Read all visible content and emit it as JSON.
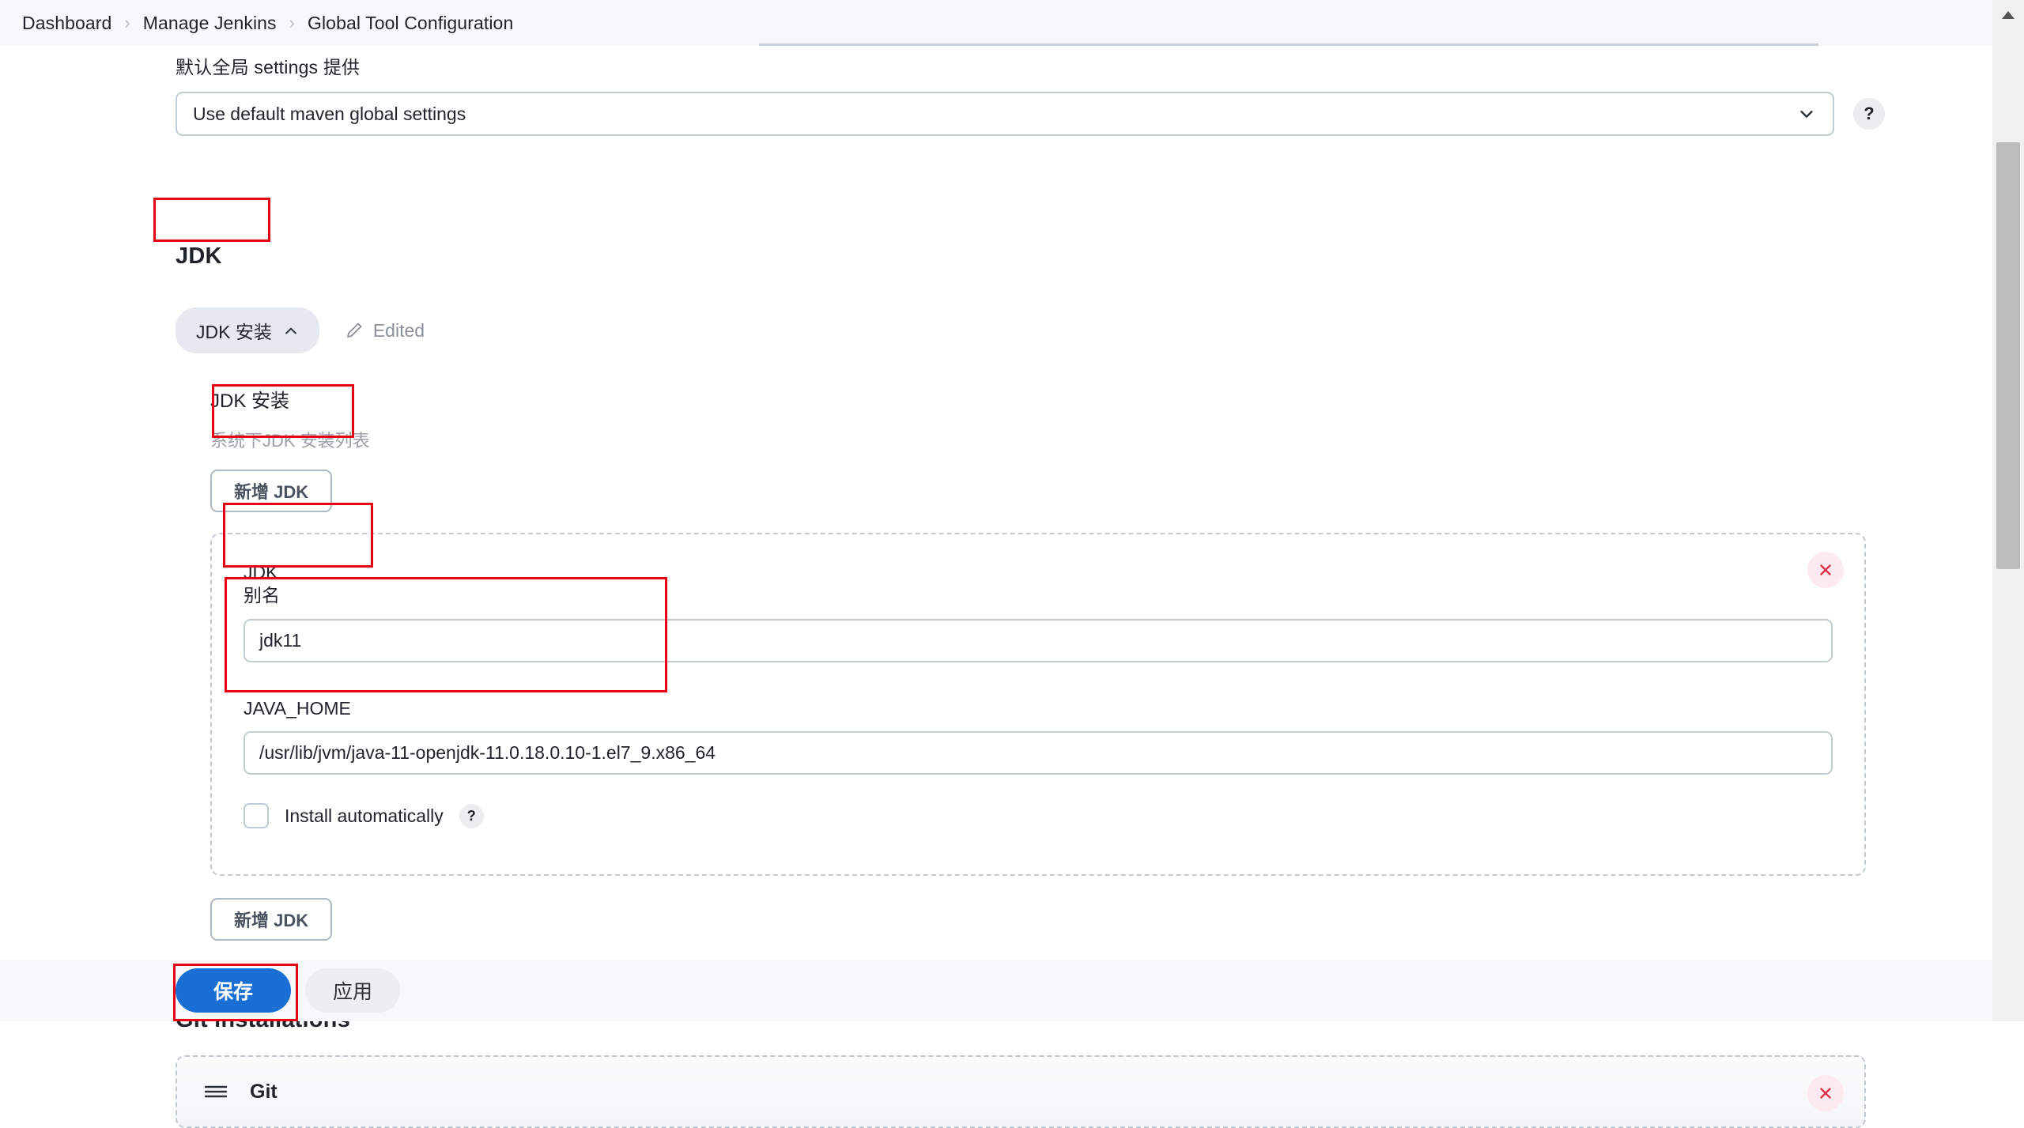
{
  "breadcrumb": {
    "items": [
      {
        "label": "Dashboard"
      },
      {
        "label": "Manage Jenkins"
      },
      {
        "label": "Global Tool Configuration"
      }
    ],
    "separator": "›"
  },
  "maven": {
    "global_settings_label": "默认全局 settings 提供",
    "global_settings_value": "Use default maven global settings",
    "help_label": "?"
  },
  "jdk_section": {
    "title": "JDK",
    "chip_label": "JDK 安装",
    "edited_label": "Edited",
    "panel_title": "JDK 安装",
    "panel_subtitle": "系统下JDK 安装列表",
    "add_button_top": "新增 JDK",
    "add_button_bottom": "新增 JDK",
    "entry": {
      "heading": "JDK",
      "alias_label": "别名",
      "alias_value": "jdk11",
      "java_home_label": "JAVA_HOME",
      "java_home_value": "/usr/lib/jvm/java-11-openjdk-11.0.18.0.10-1.el7_9.x86_64",
      "install_auto_label": "Install automatically",
      "install_auto_checked": false,
      "install_auto_help": "?",
      "delete_label": "×"
    }
  },
  "git_section": {
    "title": "Git installations",
    "row_label": "Git",
    "delete_label": "×"
  },
  "actions": {
    "save_label": "保存",
    "apply_label": "应用"
  },
  "colors": {
    "primary_blue": "#1a6fd4",
    "annotation_red": "#e60012",
    "delete_red": "#d9344a",
    "muted_text": "#9aa1a9"
  }
}
